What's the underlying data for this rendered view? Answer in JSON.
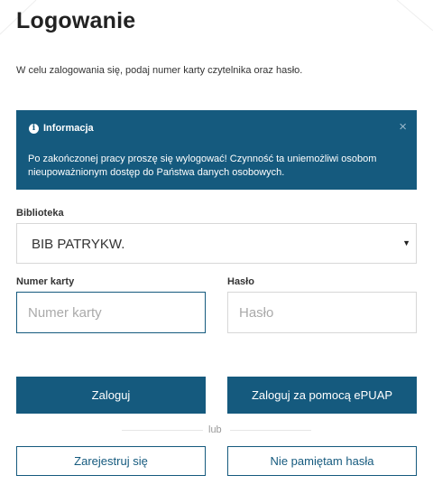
{
  "page": {
    "title": "Logowanie",
    "intro": "W celu zalogowania się, podaj numer karty czytelnika oraz hasło."
  },
  "info_box": {
    "title": "Informacja",
    "icon": "info-circle-icon",
    "text": "Po zakończonej pracy proszę się wylogować! Czynność ta uniemożliwi osobom nieupoważnionym dostęp do Państwa danych osobowych.",
    "close_symbol": "×"
  },
  "form": {
    "library_label": "Biblioteka",
    "library_value": "BIB PATRYKW.",
    "card_label": "Numer karty",
    "card_placeholder": "Numer karty",
    "card_value": "",
    "password_label": "Hasło",
    "password_placeholder": "Hasło",
    "password_value": ""
  },
  "actions": {
    "login": "Zaloguj",
    "login_epuap": "Zaloguj za pomocą ePUAP",
    "separator": "lub",
    "register": "Zarejestruj się",
    "forgot_password": "Nie pamiętam hasła"
  },
  "colors": {
    "primary": "#155a7e",
    "text": "#333333",
    "border": "#d7d7d7",
    "placeholder": "#aaaaaa"
  }
}
